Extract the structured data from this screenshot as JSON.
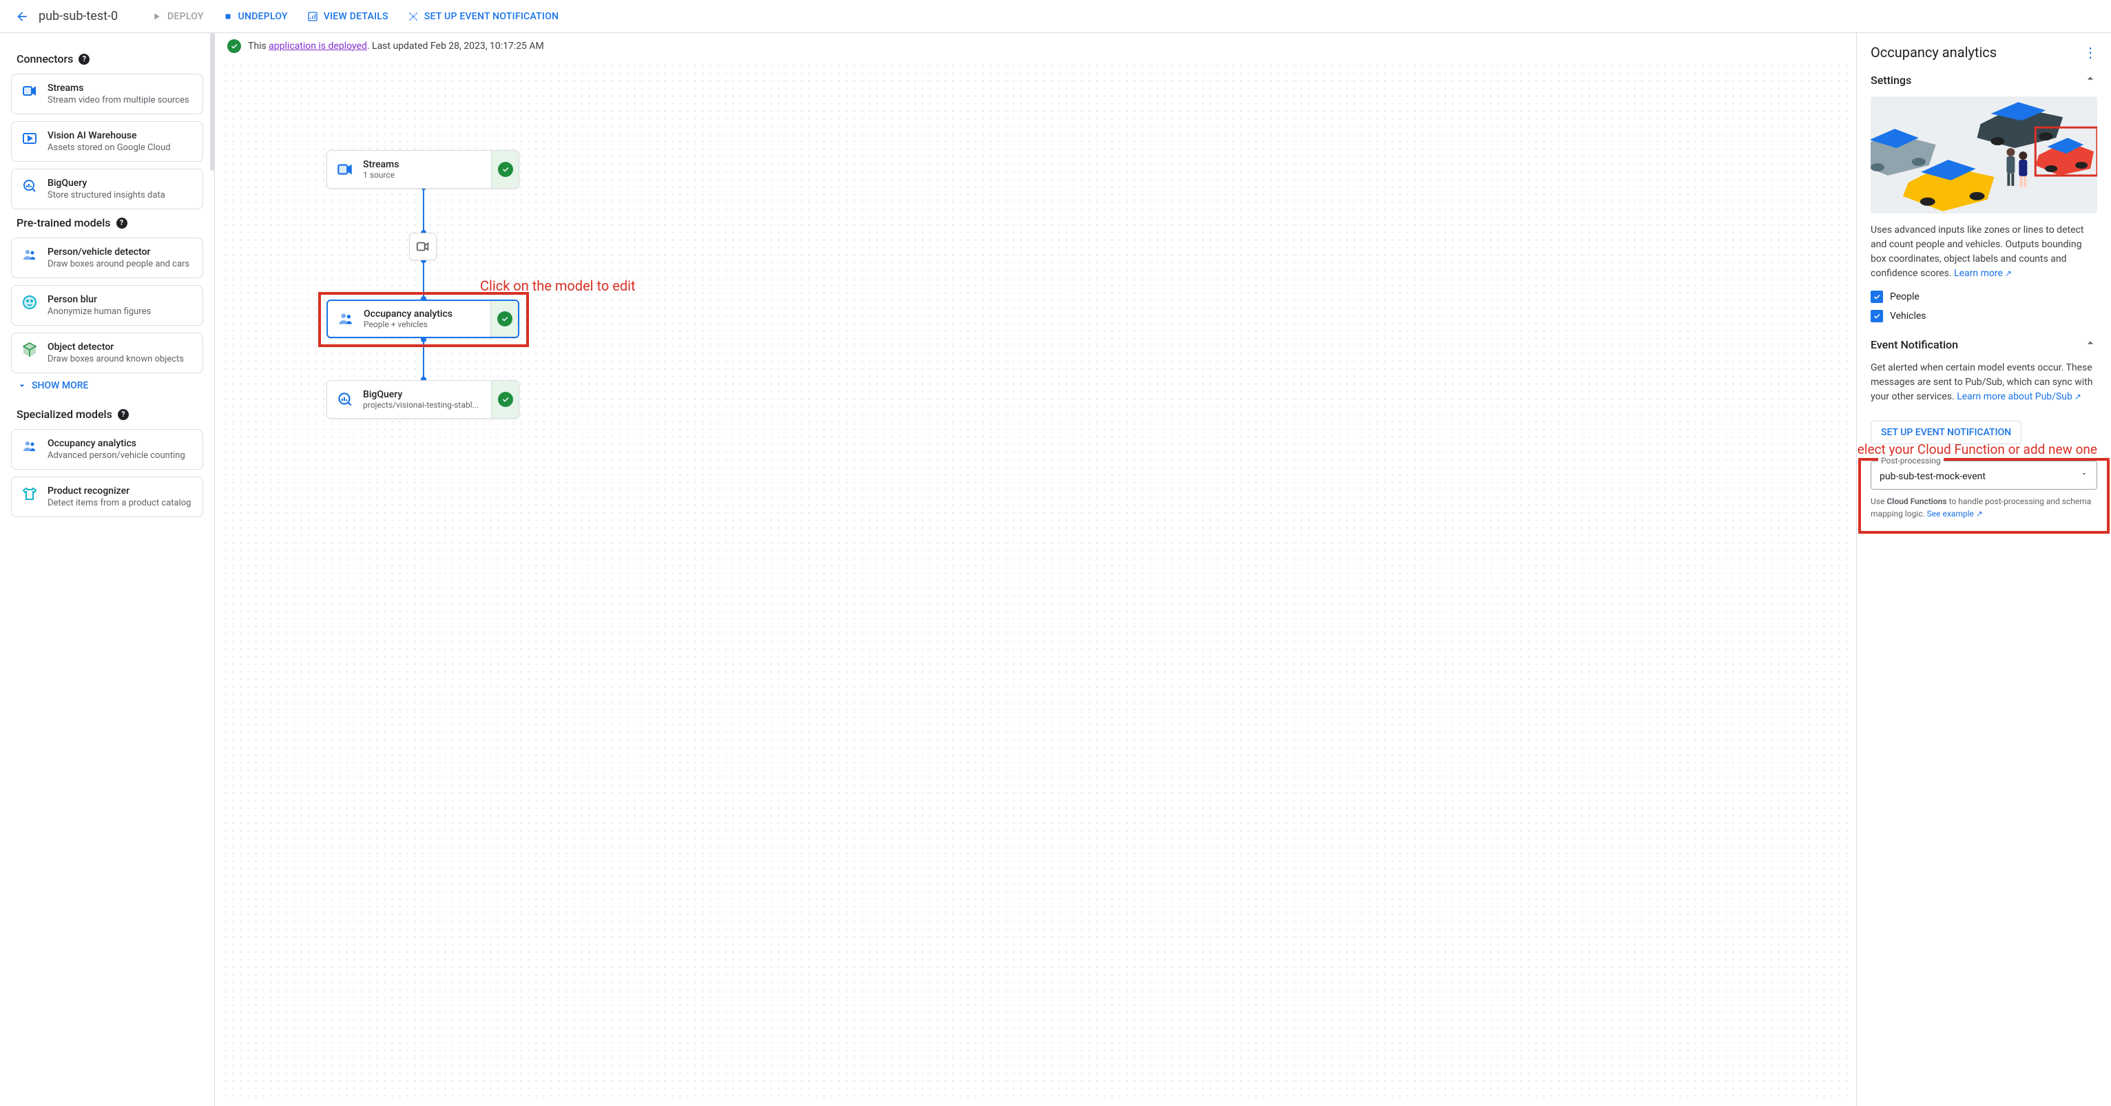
{
  "header": {
    "title": "pub-sub-test-0",
    "actions": {
      "deploy": "DEPLOY",
      "undeploy": "UNDEPLOY",
      "view": "VIEW DETAILS",
      "setup": "SET UP EVENT NOTIFICATION"
    }
  },
  "status": {
    "prefix": "This ",
    "link": "application is deployed",
    "suffix": ". Last updated Feb 28, 2023, 10:17:25 AM"
  },
  "sidebar": {
    "connectors_title": "Connectors",
    "pretrained_title": "Pre-trained models",
    "specialized_title": "Specialized models",
    "show_more": "SHOW MORE",
    "connectors": [
      {
        "title": "Streams",
        "sub": "Stream video from multiple sources"
      },
      {
        "title": "Vision AI Warehouse",
        "sub": "Assets stored on Google Cloud"
      },
      {
        "title": "BigQuery",
        "sub": "Store structured insights data"
      }
    ],
    "pretrained": [
      {
        "title": "Person/vehicle detector",
        "sub": "Draw boxes around people and cars"
      },
      {
        "title": "Person blur",
        "sub": "Anonymize human figures"
      },
      {
        "title": "Object detector",
        "sub": "Draw boxes around known objects"
      }
    ],
    "specialized": [
      {
        "title": "Occupancy analytics",
        "sub": "Advanced person/vehicle counting"
      },
      {
        "title": "Product recognizer",
        "sub": "Detect items from a product catalog"
      }
    ]
  },
  "canvas": {
    "annotation1": "Click on the model to edit",
    "annotation2": "Select your Cloud Function or add new one",
    "nodes": {
      "streams": {
        "title": "Streams",
        "sub": "1 source"
      },
      "occupancy": {
        "title": "Occupancy analytics",
        "sub": "People + vehicles"
      },
      "bigquery": {
        "title": "BigQuery",
        "sub": "projects/visionai-testing-stabl..."
      }
    }
  },
  "rpanel": {
    "title": "Occupancy analytics",
    "settings_title": "Settings",
    "desc": "Uses advanced inputs like zones or lines to detect and count people and vehicles. Outputs bounding box coordinates, object labels and counts and confidence scores. ",
    "learn_more": "Learn more",
    "cb_people": "People",
    "cb_vehicles": "Vehicles",
    "event_title": "Event Notification",
    "event_desc": "Get alerted when certain model events occur. These messages are sent to Pub/Sub, which can sync with your other services. ",
    "event_link": "Learn more about Pub/Sub",
    "setup_btn": "SET UP EVENT NOTIFICATION",
    "pp_label": "Post-processing",
    "pp_value": "pub-sub-test-mock-event",
    "pp_helper_prefix": "Use ",
    "pp_helper_bold": "Cloud Functions",
    "pp_helper_suffix": " to handle post-processing and schema mapping logic. ",
    "pp_helper_link": "See example"
  }
}
